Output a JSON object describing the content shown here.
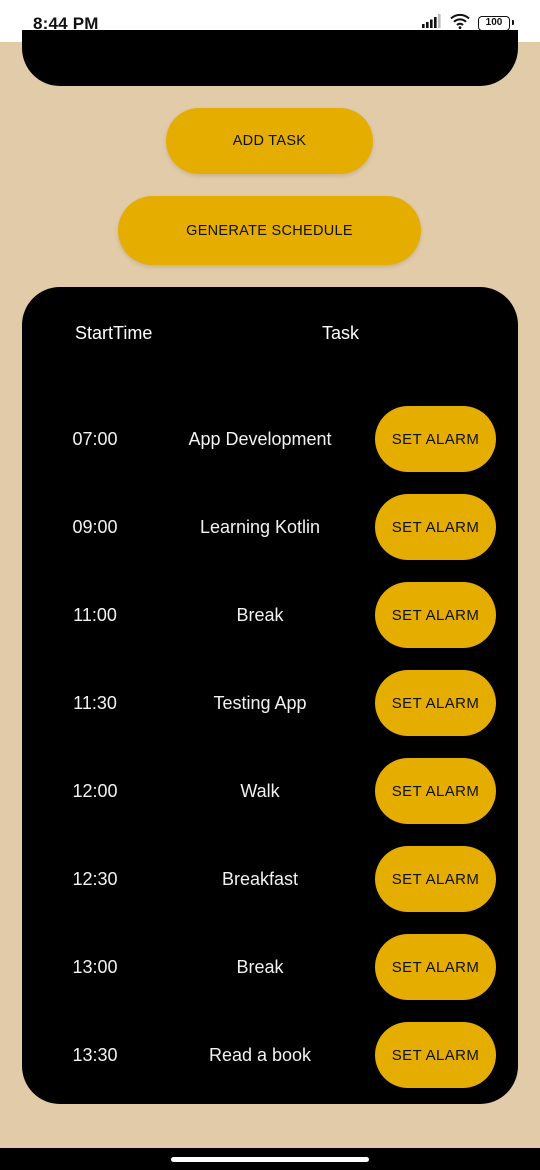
{
  "status_bar": {
    "time": "8:44 PM",
    "battery": "100",
    "icons": [
      "signal-icon",
      "wifi-icon",
      "battery-icon"
    ]
  },
  "actions": {
    "add_task": "ADD TASK",
    "generate_schedule": "GENERATE SCHEDULE"
  },
  "schedule": {
    "headers": {
      "start_time": "StartTime",
      "task": "Task"
    },
    "rows": [
      {
        "time": "07:00",
        "task": "App Development",
        "button": "SET ALARM"
      },
      {
        "time": "09:00",
        "task": "Learning Kotlin",
        "button": "SET ALARM"
      },
      {
        "time": "11:00",
        "task": "Break",
        "button": "SET ALARM"
      },
      {
        "time": "11:30",
        "task": "Testing App",
        "button": "SET ALARM"
      },
      {
        "time": "12:00",
        "task": "Walk",
        "button": "SET ALARM"
      },
      {
        "time": "12:30",
        "task": "Breakfast",
        "button": "SET ALARM"
      },
      {
        "time": "13:00",
        "task": "Break",
        "button": "SET ALARM"
      },
      {
        "time": "13:30",
        "task": "Read a book",
        "button": "SET ALARM"
      }
    ]
  },
  "colors": {
    "background": "#e2cba8",
    "accent": "#e4ad00",
    "card": "#000000"
  }
}
